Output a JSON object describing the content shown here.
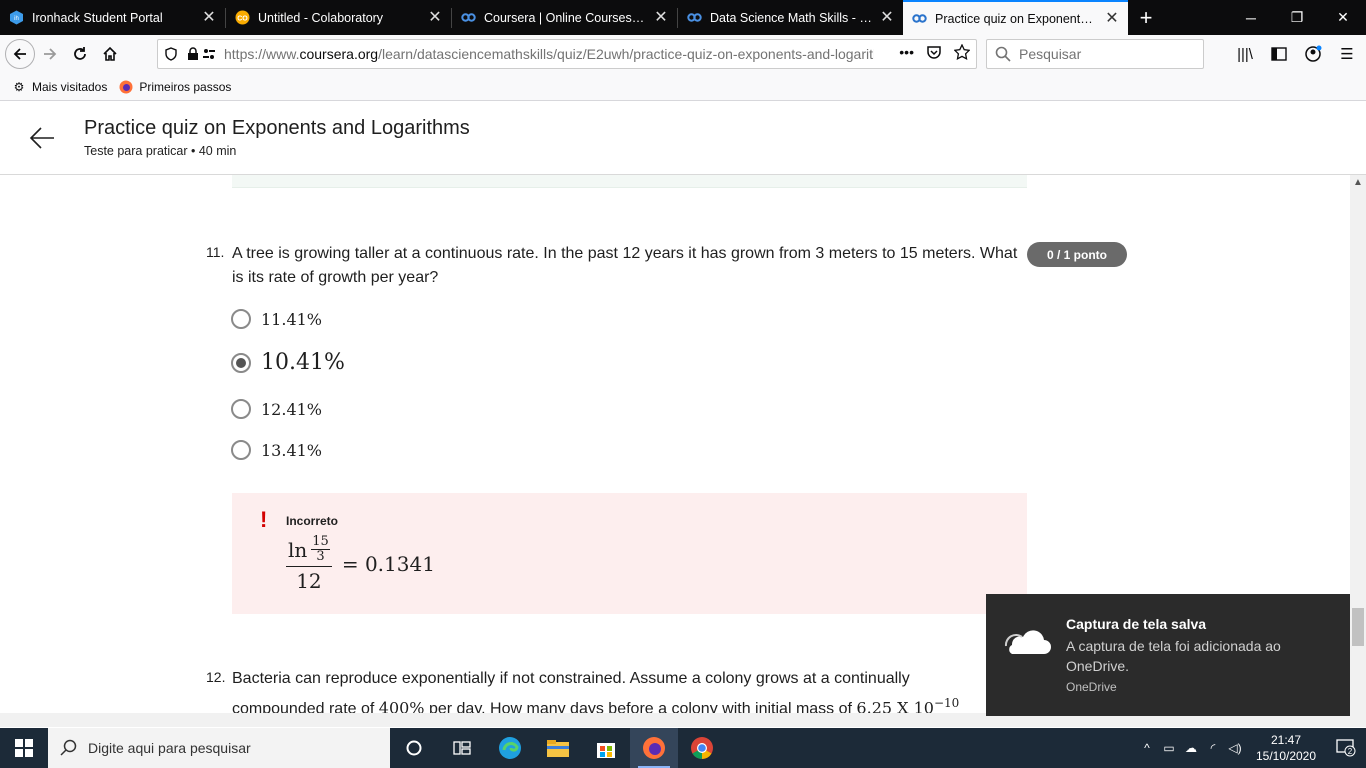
{
  "browser": {
    "tabs": [
      {
        "title": "Ironhack Student Portal",
        "icon": "ironhack-icon"
      },
      {
        "title": "Untitled - Colaboratory",
        "icon": "colab-icon"
      },
      {
        "title": "Coursera | Online Courses & Cre",
        "icon": "coursera-icon"
      },
      {
        "title": "Data Science Math Skills - Págin",
        "icon": "coursera-icon"
      },
      {
        "title": "Practice quiz on Exponents and",
        "icon": "coursera-icon"
      }
    ],
    "url_prefix": "https://www.",
    "url_domain": "coursera.org",
    "url_path": "/learn/datasciencemathskills/quiz/E2uwh/practice-quiz-on-exponents-and-logarith",
    "search_placeholder": "Pesquisar",
    "bookmarks": [
      {
        "label": "Mais visitados",
        "icon": "gear-icon"
      },
      {
        "label": "Primeiros passos",
        "icon": "firefox-icon"
      }
    ]
  },
  "header": {
    "title": "Practice quiz on Exponents and Logarithms",
    "subtitle": "Teste para praticar • 40 min"
  },
  "question11": {
    "number": "11.",
    "text": "A tree is growing taller at a continuous rate. In the past 12 years it has grown from 3 meters to 15 meters. What is its rate of growth per year?",
    "score": "0 / 1 ponto",
    "options": [
      {
        "label": "11.41%",
        "selected": false
      },
      {
        "label": "10.41%",
        "selected": true
      },
      {
        "label": "12.41%",
        "selected": false
      },
      {
        "label": "13.41%",
        "selected": false
      }
    ],
    "feedback": {
      "mark": "!",
      "status": "Incorreto",
      "ln": "ln",
      "inner_num": "15",
      "inner_den": "3",
      "denominator": "12",
      "result": "= 0.1341"
    }
  },
  "question12": {
    "number": "12.",
    "text_line1": "Bacteria can reproduce exponentially if not constrained. Assume a colony grows at a continually",
    "text_line2_start": "compounded rate of ",
    "rate": "400%",
    "text_line2_mid": " per day. How many days before a colony with initial mass of ",
    "mass": "6.25 X 10",
    "exponent": "−10"
  },
  "toast": {
    "title": "Captura de tela salva",
    "body": "A captura de tela foi adicionada ao OneDrive.",
    "source": "OneDrive"
  },
  "taskbar": {
    "search_placeholder": "Digite aqui para pesquisar",
    "time": "21:47",
    "date": "15/10/2020",
    "notifications": "2"
  }
}
